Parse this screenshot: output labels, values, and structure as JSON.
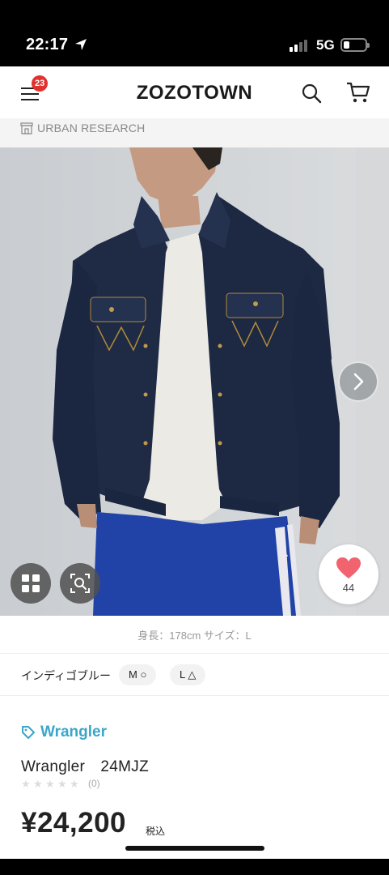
{
  "status_bar": {
    "time": "22:17",
    "network": "5G",
    "icons": [
      "location-arrow-icon",
      "signal-icon",
      "battery-icon"
    ]
  },
  "header": {
    "logo": "ZOZOTOWN",
    "menu_badge": "23",
    "icons": [
      "menu-icon",
      "search-icon",
      "cart-icon"
    ]
  },
  "shop": {
    "name": "URBAN RESEARCH",
    "icon": "store-icon"
  },
  "gallery": {
    "favorite_count": "44",
    "icons": [
      "chevron-right-icon",
      "grid-icon",
      "image-search-icon",
      "heart-icon"
    ],
    "colors": {
      "heart": "#f0636f"
    }
  },
  "product": {
    "model_info": "身長：178cm サイズ：L",
    "color_label": "インディゴブルー",
    "sizes": [
      {
        "label": "M ○"
      },
      {
        "label": "L △"
      }
    ],
    "brand": "Wrangler",
    "name": "Wrangler　24MJZ",
    "rating_count": "(0)",
    "price": "¥24,200",
    "tax_label": "税込",
    "colors": {
      "brand_link": "#3aa6c8"
    }
  }
}
